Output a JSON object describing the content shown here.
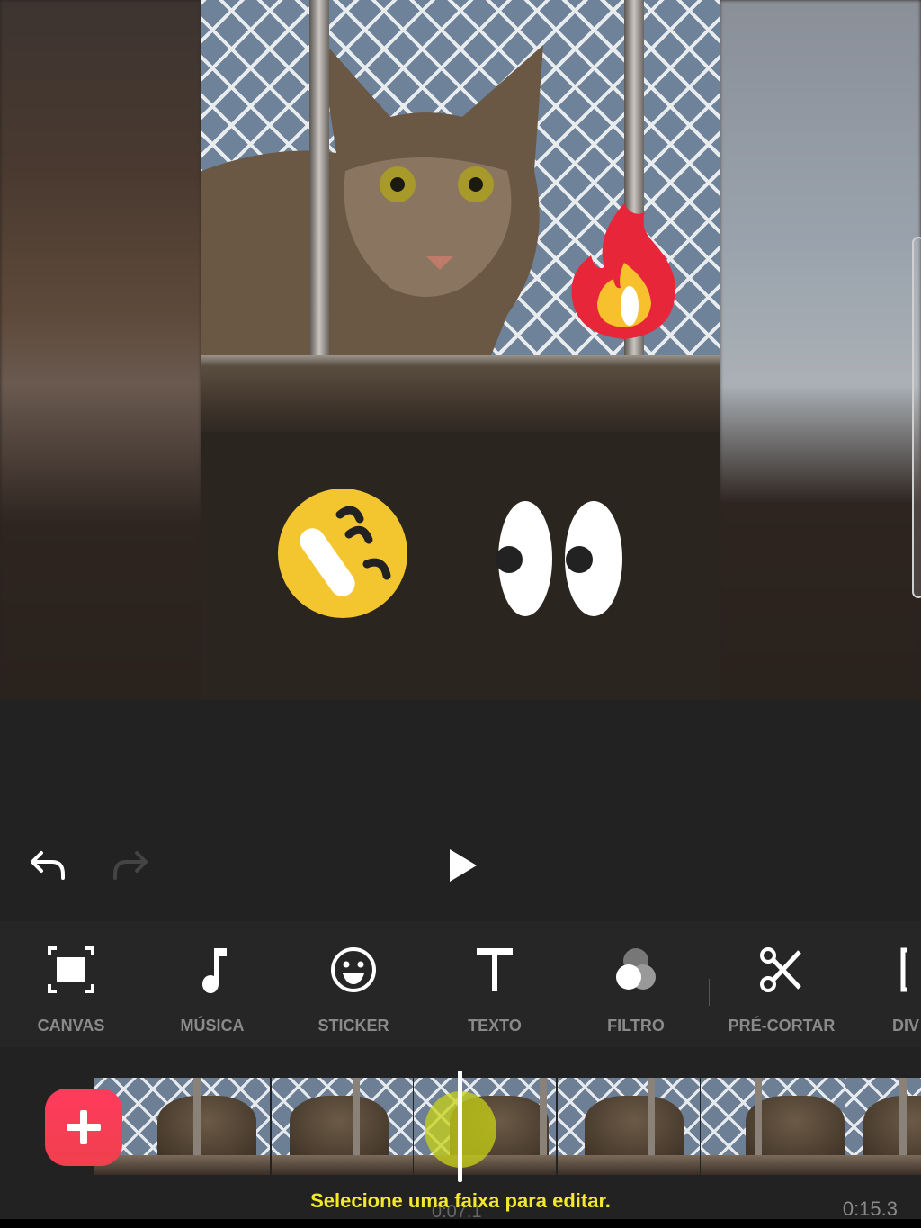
{
  "preview": {
    "stickers": [
      "fire-sticker",
      "laughing-face-sticker",
      "eyes-sticker"
    ]
  },
  "controls": {
    "undo_icon": "undo-icon",
    "redo_icon": "redo-icon",
    "play_icon": "play-icon"
  },
  "toolbar": {
    "items": [
      {
        "label": "CANVAS",
        "icon": "canvas-icon"
      },
      {
        "label": "MÚSICA",
        "icon": "music-note-icon"
      },
      {
        "label": "STICKER",
        "icon": "smiley-icon"
      },
      {
        "label": "TEXTO",
        "icon": "text-icon"
      },
      {
        "label": "FILTRO",
        "icon": "filter-icon"
      },
      {
        "label": "PRÉ-CORTAR",
        "icon": "scissors-icon"
      },
      {
        "label": "DIV",
        "icon": "split-icon"
      }
    ]
  },
  "timeline": {
    "hint": "Selecione uma faixa para editar.",
    "current_time": "0:07.1",
    "total_time": "0:15.3",
    "add_color": "#ff3b5c",
    "hint_color": "#f3e82a"
  }
}
